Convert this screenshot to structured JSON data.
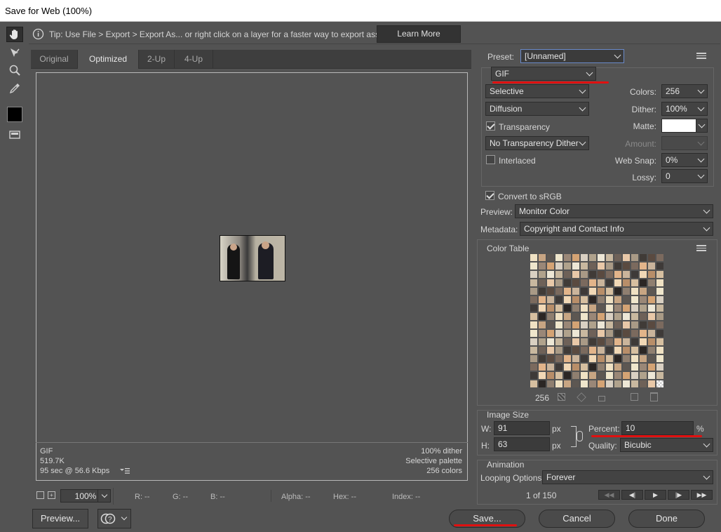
{
  "window": {
    "title": "Save for Web (100%)"
  },
  "tip": {
    "text": "Tip: Use File > Export > Export As...  or right click on a layer for a faster way to export assets",
    "learn_more": "Learn More"
  },
  "tabs": [
    {
      "label": "Original",
      "active": false
    },
    {
      "label": "Optimized",
      "active": true
    },
    {
      "label": "2-Up",
      "active": false
    },
    {
      "label": "4-Up",
      "active": false
    }
  ],
  "info": {
    "format": "GIF",
    "size": "519.7K",
    "time": "95 sec @ 56.6 Kbps",
    "dither": "100% dither",
    "palette": "Selective palette",
    "colors": "256 colors"
  },
  "status": {
    "zoom": "100%",
    "r": "R: --",
    "g": "G: --",
    "b": "B: --",
    "alpha": "Alpha: --",
    "hex": "Hex: --",
    "index": "Index: --"
  },
  "buttons": {
    "preview": "Preview...",
    "save": "Save...",
    "cancel": "Cancel",
    "done": "Done"
  },
  "settings": {
    "preset_label": "Preset:",
    "preset_value": "[Unnamed]",
    "format": "GIF",
    "reduction": "Selective",
    "dither_algo": "Diffusion",
    "transparency_label": "Transparency",
    "transparency_checked": true,
    "transparency_dither": "No Transparency Dither",
    "interlaced_label": "Interlaced",
    "interlaced_checked": false,
    "colors_label": "Colors:",
    "colors_value": "256",
    "dither_label": "Dither:",
    "dither_value": "100%",
    "matte_label": "Matte:",
    "amount_label": "Amount:",
    "websnap_label": "Web Snap:",
    "websnap_value": "0%",
    "lossy_label": "Lossy:",
    "lossy_value": "0",
    "convert_label": "Convert to sRGB",
    "convert_checked": true,
    "preview_label": "Preview:",
    "preview_value": "Monitor Color",
    "metadata_label": "Metadata:",
    "metadata_value": "Copyright and Contact Info"
  },
  "color_table": {
    "title": "Color Table",
    "count": "256",
    "palette": [
      "#efe1c3",
      "#b0a28c",
      "#5a4a40",
      "#d6bfa0",
      "#9a8777",
      "#e8c8a8",
      "#3e3a38",
      "#c7a583",
      "#ede7d6",
      "#7b6a5e",
      "#2b2624",
      "#d4a374",
      "#a99a86",
      "#f1d8b6",
      "#5d5752",
      "#c8b89f",
      "#e2b48a",
      "#8f7f70",
      "#d9d0c2",
      "#403b37",
      "#b88e69",
      "#efe6cc",
      "#6e6158",
      "#cab49b"
    ]
  },
  "image_size": {
    "title": "Image Size",
    "w_label": "W:",
    "w_value": "91",
    "h_label": "H:",
    "h_value": "63",
    "unit": "px",
    "percent_label": "Percent:",
    "percent_value": "10",
    "percent_unit": "%",
    "quality_label": "Quality:",
    "quality_value": "Bicubic"
  },
  "animation": {
    "title": "Animation",
    "looping_label": "Looping Options:",
    "looping_value": "Forever",
    "frame": "1 of 150"
  }
}
